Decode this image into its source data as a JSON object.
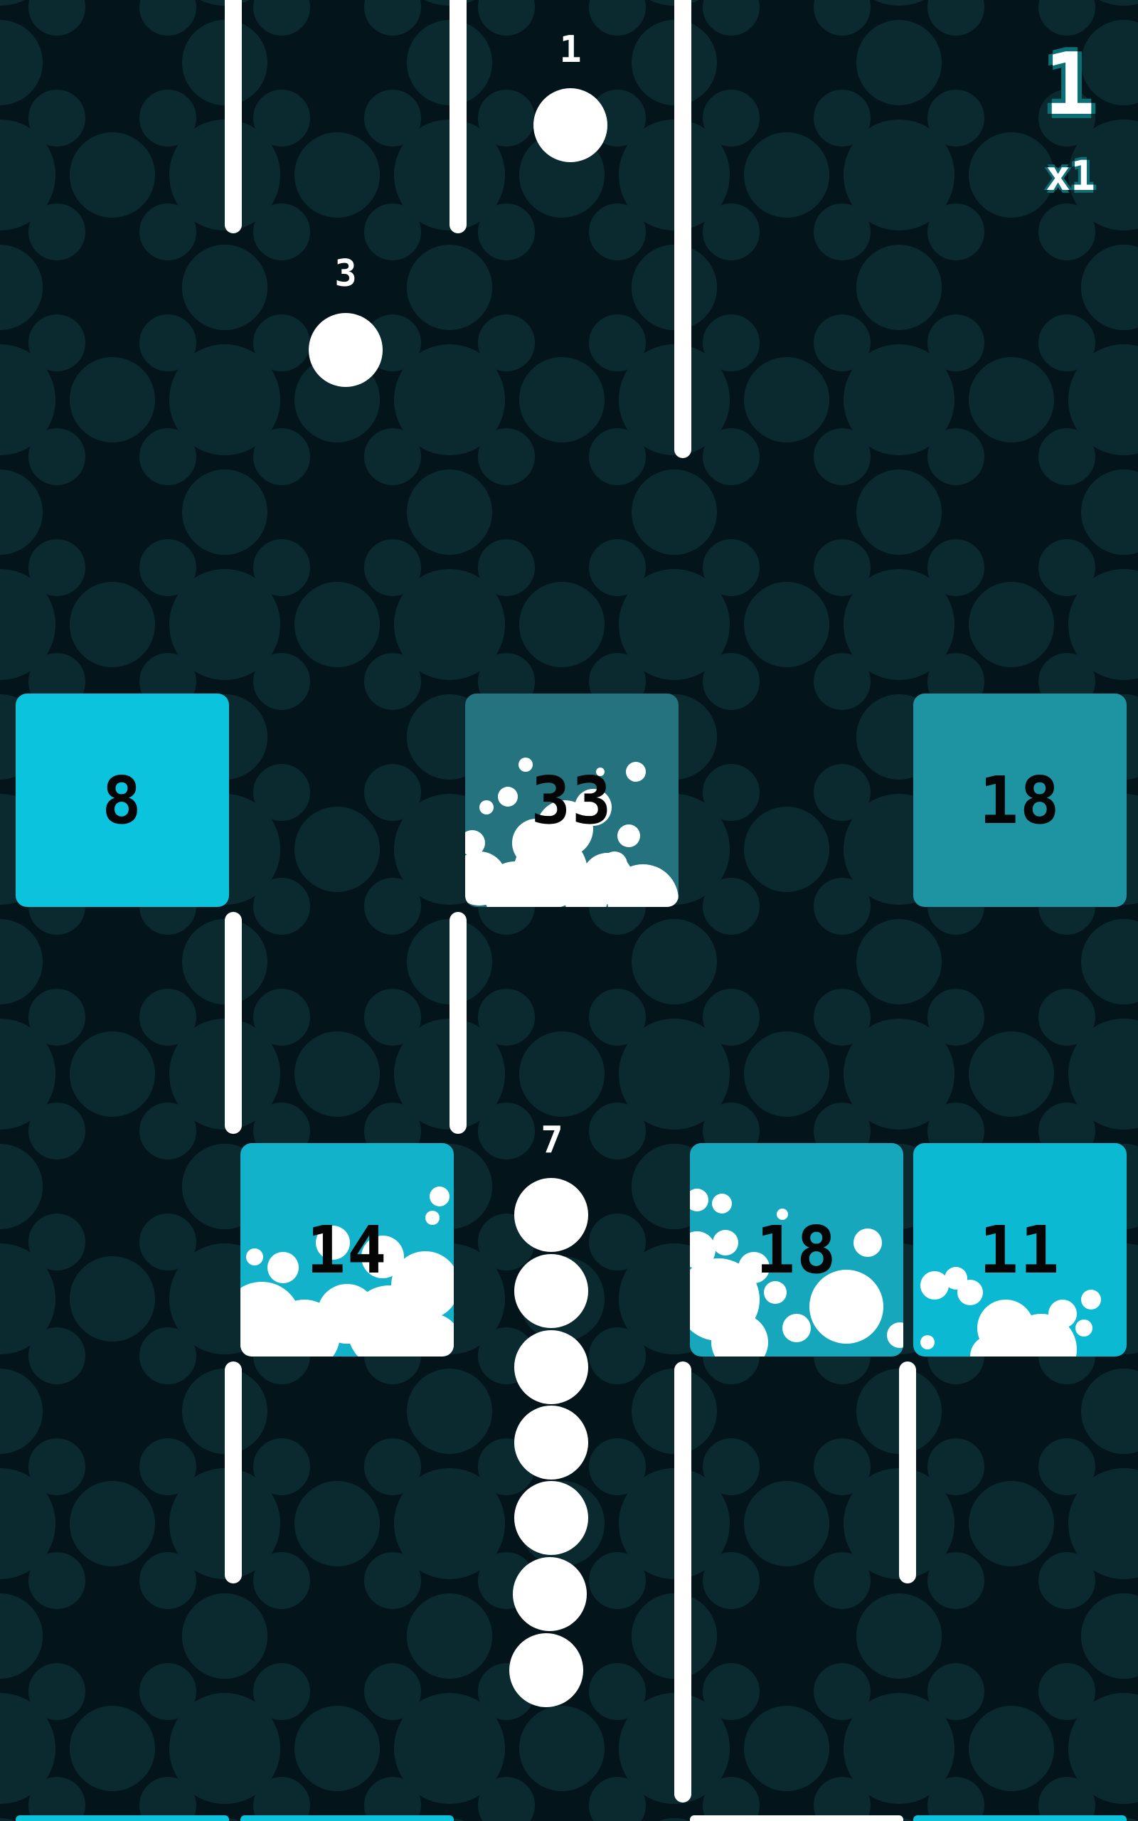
{
  "hud": {
    "score": "1",
    "multiplier": "x1"
  },
  "colors": {
    "background": "#03151a",
    "pattern": "#0b2a30",
    "wall": "#ffffff",
    "ball": "#ffffff",
    "block_bright": "#0cc3dd",
    "block_mid": "#17a7bd",
    "block_dark": "#1e93a2",
    "block_darkest": "#25737e"
  },
  "blocks": [
    {
      "value": "8",
      "color": "#0cc3dd",
      "splat": "none"
    },
    {
      "value": "33",
      "color": "#25737e",
      "splat": "heavy"
    },
    {
      "value": "18",
      "color": "#1e93a2",
      "splat": "none"
    },
    {
      "value": "14",
      "color": "#12b2ca",
      "splat": "heavy"
    },
    {
      "value": "18",
      "color": "#17a7bd",
      "splat": "heavy"
    },
    {
      "value": "11",
      "color": "#0cb9d3",
      "splat": "medium"
    }
  ],
  "pickups": [
    {
      "label": "1",
      "icon": "ball-pickup"
    },
    {
      "label": "3",
      "icon": "ball-pickup"
    }
  ],
  "snake": {
    "length_label": "7",
    "segments": 7
  }
}
